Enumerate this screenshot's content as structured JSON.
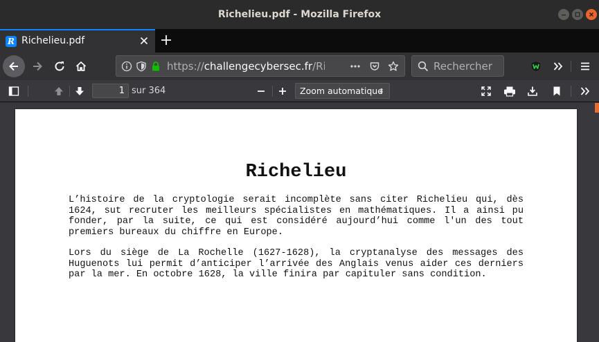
{
  "window": {
    "title": "Richelieu.pdf - Mozilla Firefox"
  },
  "tab": {
    "favicon_letter": "R",
    "title": "Richelieu.pdf"
  },
  "urlbar": {
    "scheme": "https://",
    "host": "challengecybersec.fr",
    "path": "/Richelieu.pdf"
  },
  "searchbar": {
    "placeholder": "Rechercher"
  },
  "pdf_toolbar": {
    "page_number": "1",
    "page_count": "sur 364",
    "zoom": "Zoom automatique"
  },
  "document": {
    "title": "Richelieu",
    "paragraphs": [
      "L’histoire de la cryptologie serait incomplète sans citer Richelieu qui, dès 1624, sut recruter les meilleurs spécialistes en mathématiques. Il a ainsi pu fonder, par la suite, ce qui est considéré aujourd’hui comme l'un des tout premiers bureaux du chiffre en Europe.",
      "Lors du siège de La Rochelle (1627-1628), la cryptanalyse des messages des Huguenots lui permit d’anticiper l’arrivée des Anglais venus aider ces derniers par la mer. En octobre 1628, la ville finira par capituler sans condition."
    ]
  },
  "colors": {
    "accent": "#0a84ff",
    "secure_lock": "#12bc00",
    "window_close": "#e9652f"
  }
}
